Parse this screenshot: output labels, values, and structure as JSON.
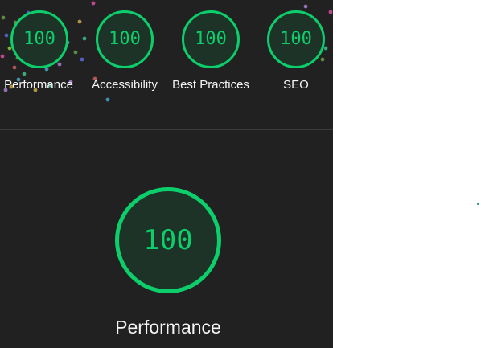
{
  "report": {
    "gauges": [
      {
        "value": "100",
        "label": "Performance"
      },
      {
        "value": "100",
        "label": "Accessibility"
      },
      {
        "value": "100",
        "label": "Best Practices"
      },
      {
        "value": "100",
        "label": "SEO"
      }
    ],
    "main_gauge": {
      "value": "100",
      "label": "Performance"
    }
  },
  "colors": {
    "pass": "#0cce6b",
    "background": "#212121",
    "text": "#f5f5f5"
  }
}
